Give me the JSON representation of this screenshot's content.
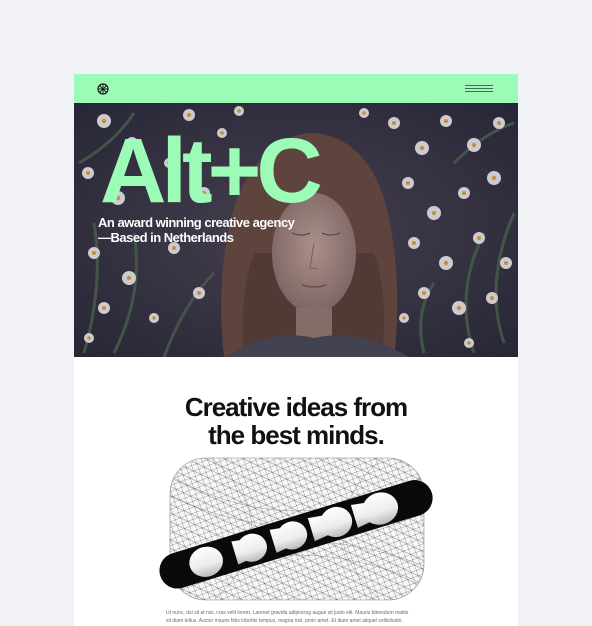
{
  "hero": {
    "title": "Alt+C",
    "line1": "An award winning creative agency",
    "line2": "—Based in Netherlands"
  },
  "headline": {
    "line1": "Creative ideas from",
    "line2": "the best minds."
  },
  "body": {
    "line1": "Ut nunc, dui sit at nisi, cras velit lorem. Laoreet gravida adipiscing augue sit justo elit. Mauris bibendum mattis",
    "line2": "sit diam tellus. Auctor mauris felis lobortis tempus, magna nisl, proin amet. Et diam amet aliquet sollicitudin."
  },
  "colors": {
    "accent": "#9bfbb7",
    "page_background": "#f0f2f5"
  },
  "icons": {
    "logo": "flower-icon",
    "menu": "hamburger-menu-icon"
  }
}
